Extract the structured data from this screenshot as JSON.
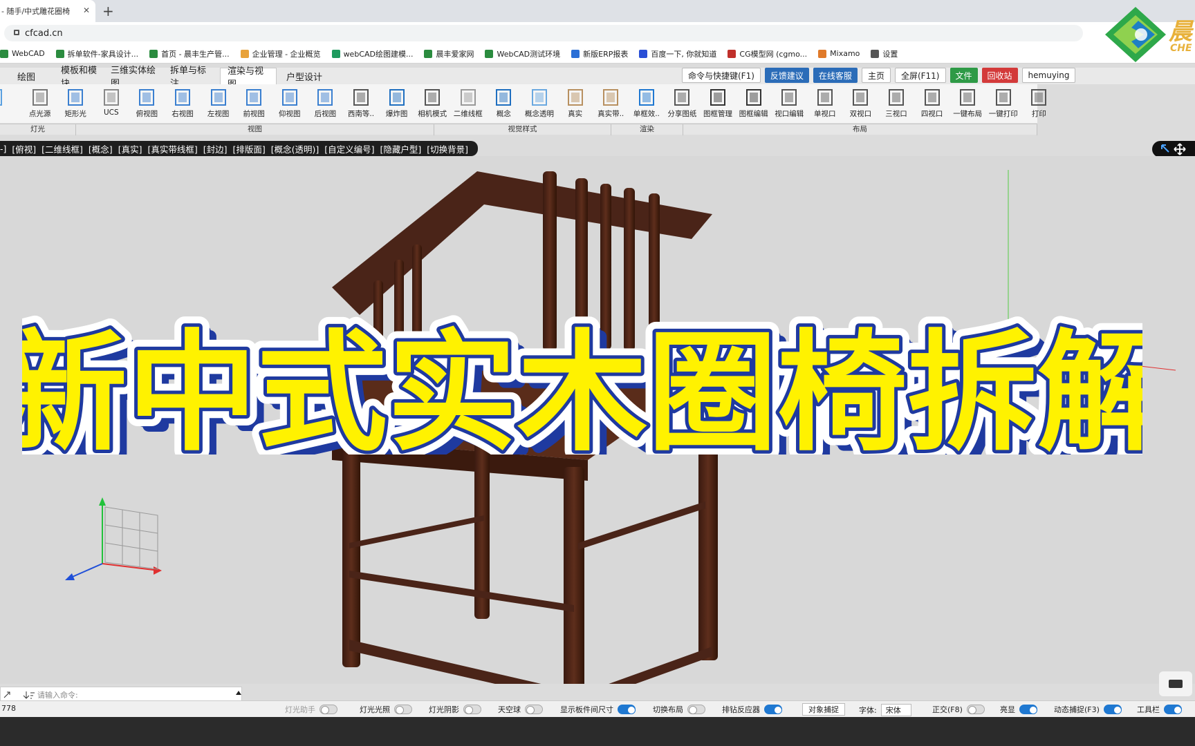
{
  "browser": {
    "tab_title": "- 随手/中式雕花圈椅",
    "tab_close": "✕",
    "new_tab": "+",
    "url": "cfcad.cn"
  },
  "bookmarks": [
    {
      "label": "WebCAD",
      "color": "#2b8c3f"
    },
    {
      "label": "拆单软件-家具设计...",
      "color": "#2b8c3f"
    },
    {
      "label": "首页 - 晨丰生产管...",
      "color": "#2b8c3f"
    },
    {
      "label": "企业管理 - 企业概览",
      "color": "#e8a23a"
    },
    {
      "label": "webCAD绘图建模...",
      "color": "#1e9a5e"
    },
    {
      "label": "晨丰爱家网",
      "color": "#2b8c3f"
    },
    {
      "label": "WebCAD测试环境",
      "color": "#2b8c3f"
    },
    {
      "label": "新版ERP报表",
      "color": "#2a6fd6"
    },
    {
      "label": "百度一下, 你就知道",
      "color": "#2a4fd6"
    },
    {
      "label": "CG模型网 (cgmo...",
      "color": "#c0302b"
    },
    {
      "label": "Mixamo",
      "color": "#e07a2a"
    },
    {
      "label": "设置",
      "color": "#555555"
    }
  ],
  "logo": {
    "text": "晨",
    "sub": "CHE"
  },
  "ribbon": {
    "tabs": [
      "绘图",
      "模板和模块",
      "三维实体绘图",
      "拆单与标注",
      "渲染与视图",
      "户型设计"
    ],
    "active_tab": "渲染与视图",
    "top_buttons": [
      {
        "label": "命令与快捷键(F1)",
        "style": "white"
      },
      {
        "label": "反馈建议",
        "style": "blue"
      },
      {
        "label": "在线客服",
        "style": "blue"
      },
      {
        "label": "主页",
        "style": "white"
      },
      {
        "label": "全屏(F11)",
        "style": "white"
      },
      {
        "label": "文件",
        "style": "green"
      },
      {
        "label": "回收站",
        "style": "red"
      },
      {
        "label": "hemuying",
        "style": "white"
      }
    ],
    "tools": [
      "灯",
      "点光源",
      "矩形光",
      "UCS",
      "俯视图",
      "右视图",
      "左视图",
      "前视图",
      "仰视图",
      "后视图",
      "西南等..",
      "爆炸图",
      "相机模式",
      "二维线框",
      "概念",
      "概念透明",
      "真实",
      "真实带..",
      "单框效..",
      "分享图纸",
      "图框管理",
      "图框编辑",
      "视口编辑",
      "单视口",
      "双视口",
      "三视口",
      "四视口",
      "一键布局",
      "一键打印",
      "打印"
    ],
    "groups": [
      "灯光",
      "视图",
      "视觉样式",
      "渲染",
      "布局"
    ]
  },
  "viewbar": {
    "items": [
      "-]",
      "[俯视]",
      "[二维线框]",
      "[概念]",
      "[真实]",
      "[真实带线框]",
      "[封边]",
      "[排版面]",
      "[概念(透明)]",
      "[自定义编号]",
      "[隐藏户型]",
      "[切换背景]"
    ]
  },
  "headline": "新中式实木圈椅拆解",
  "command": {
    "placeholder": "请输入命令:",
    "coord": "778"
  },
  "status": [
    {
      "label": "灯光助手",
      "on": false,
      "disabled": true
    },
    {
      "label": "灯光光照",
      "on": false
    },
    {
      "label": "灯光阴影",
      "on": false
    },
    {
      "label": "天空球",
      "on": false
    },
    {
      "label": "显示板件间尺寸",
      "on": true
    },
    {
      "label": "切换布局",
      "on": false
    },
    {
      "label": "排钻反应器",
      "on": true
    },
    {
      "label": "对象捕捉",
      "button": true
    },
    {
      "label": "字体:",
      "font": "宋体"
    },
    {
      "label": "正交(F8)",
      "on": false
    },
    {
      "label": "亮显",
      "on": true
    },
    {
      "label": "动态捕捉(F3)",
      "on": true
    },
    {
      "label": "工具栏",
      "on": true
    }
  ],
  "colors": {
    "accent_blue": "#2b6cb8",
    "wood": "#4a2418",
    "headline_fill": "#fff200",
    "headline_stroke": "#1f3aa0"
  }
}
